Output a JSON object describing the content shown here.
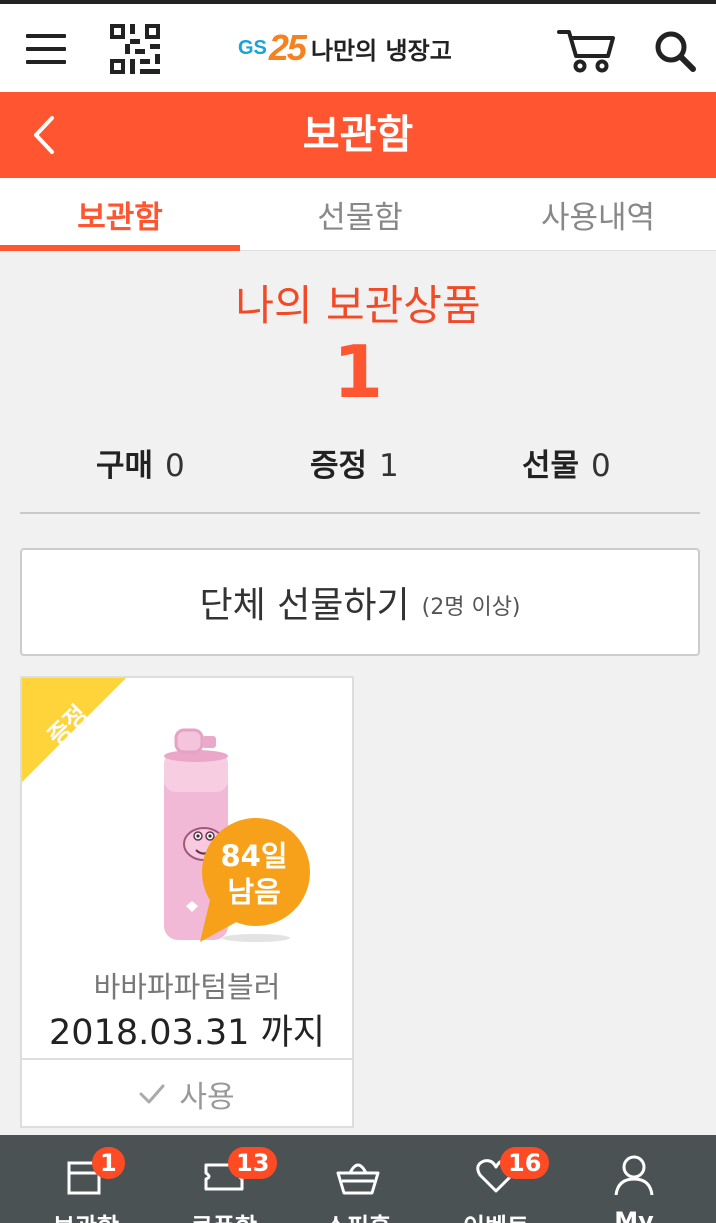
{
  "header": {
    "logo_brand": "GS",
    "logo_number": "25",
    "logo_text": "나만의 냉장고",
    "icons": [
      "menu-icon",
      "qr-code-icon",
      "cart-icon",
      "search-icon"
    ]
  },
  "page": {
    "title": "보관함",
    "back_icon": "chevron-left-icon",
    "accent_color": "#ff5530"
  },
  "tabs": [
    {
      "label": "보관함",
      "active": true
    },
    {
      "label": "선물함",
      "active": false
    },
    {
      "label": "사용내역",
      "active": false
    }
  ],
  "summary": {
    "title": "나의 보관상품",
    "count": "1",
    "stats": [
      {
        "label": "구매",
        "value": "0"
      },
      {
        "label": "증정",
        "value": "1"
      },
      {
        "label": "선물",
        "value": "0"
      }
    ]
  },
  "group_gift": {
    "label": "단체 선물하기",
    "sub": "(2명 이상)"
  },
  "items": [
    {
      "ribbon": "증정",
      "ribbon_color": "#ffd43b",
      "days_left_line1": "84일",
      "days_left_line2": "남음",
      "badge_color": "#f7a11a",
      "name": "바바파파텀블러",
      "expiry": "2018.03.31 까지",
      "use_label": "사용"
    }
  ],
  "bottom_nav": [
    {
      "label": "보관함",
      "icon": "storage-box-icon",
      "badge": "1"
    },
    {
      "label": "쿠폰함",
      "icon": "coupon-icon",
      "badge": "13"
    },
    {
      "label": "쇼핑홈",
      "icon": "shopping-basket-icon",
      "badge": ""
    },
    {
      "label": "이벤트",
      "icon": "heart-icon",
      "badge": "16"
    },
    {
      "label": "My",
      "icon": "user-icon",
      "badge": ""
    }
  ]
}
